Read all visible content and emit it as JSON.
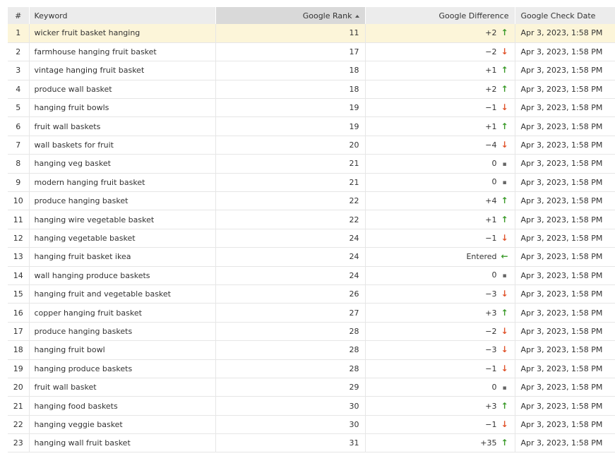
{
  "headers": {
    "num": "#",
    "keyword": "Keyword",
    "rank": "Google Rank",
    "difference": "Google Difference",
    "date": "Google Check Date"
  },
  "colors": {
    "up": "#3a9a29",
    "down": "#e0532b",
    "selected_row": "#fcf5d9"
  },
  "rows": [
    {
      "num": "1",
      "keyword": "wicker fruit basket hanging",
      "rank": "11",
      "diff": "+2",
      "trend": "up",
      "date": "Apr 3, 2023, 1:58 PM"
    },
    {
      "num": "2",
      "keyword": "farmhouse hanging fruit basket",
      "rank": "17",
      "diff": "−2",
      "trend": "down",
      "date": "Apr 3, 2023, 1:58 PM"
    },
    {
      "num": "3",
      "keyword": "vintage hanging fruit basket",
      "rank": "18",
      "diff": "+1",
      "trend": "up",
      "date": "Apr 3, 2023, 1:58 PM"
    },
    {
      "num": "4",
      "keyword": "produce wall basket",
      "rank": "18",
      "diff": "+2",
      "trend": "up",
      "date": "Apr 3, 2023, 1:58 PM"
    },
    {
      "num": "5",
      "keyword": "hanging fruit bowls",
      "rank": "19",
      "diff": "−1",
      "trend": "down",
      "date": "Apr 3, 2023, 1:58 PM"
    },
    {
      "num": "6",
      "keyword": "fruit wall baskets",
      "rank": "19",
      "diff": "+1",
      "trend": "up",
      "date": "Apr 3, 2023, 1:58 PM"
    },
    {
      "num": "7",
      "keyword": "wall baskets for fruit",
      "rank": "20",
      "diff": "−4",
      "trend": "down",
      "date": "Apr 3, 2023, 1:58 PM"
    },
    {
      "num": "8",
      "keyword": "hanging veg basket",
      "rank": "21",
      "diff": "0",
      "trend": "same",
      "date": "Apr 3, 2023, 1:58 PM"
    },
    {
      "num": "9",
      "keyword": "modern hanging fruit basket",
      "rank": "21",
      "diff": "0",
      "trend": "same",
      "date": "Apr 3, 2023, 1:58 PM"
    },
    {
      "num": "10",
      "keyword": "produce hanging basket",
      "rank": "22",
      "diff": "+4",
      "trend": "up",
      "date": "Apr 3, 2023, 1:58 PM"
    },
    {
      "num": "11",
      "keyword": "hanging wire vegetable basket",
      "rank": "22",
      "diff": "+1",
      "trend": "up",
      "date": "Apr 3, 2023, 1:58 PM"
    },
    {
      "num": "12",
      "keyword": "hanging vegetable basket",
      "rank": "24",
      "diff": "−1",
      "trend": "down",
      "date": "Apr 3, 2023, 1:58 PM"
    },
    {
      "num": "13",
      "keyword": "hanging fruit basket ikea",
      "rank": "24",
      "diff": "Entered",
      "trend": "entered",
      "date": "Apr 3, 2023, 1:58 PM"
    },
    {
      "num": "14",
      "keyword": "wall hanging produce baskets",
      "rank": "24",
      "diff": "0",
      "trend": "same",
      "date": "Apr 3, 2023, 1:58 PM"
    },
    {
      "num": "15",
      "keyword": "hanging fruit and vegetable basket",
      "rank": "26",
      "diff": "−3",
      "trend": "down",
      "date": "Apr 3, 2023, 1:58 PM"
    },
    {
      "num": "16",
      "keyword": "copper hanging fruit basket",
      "rank": "27",
      "diff": "+3",
      "trend": "up",
      "date": "Apr 3, 2023, 1:58 PM"
    },
    {
      "num": "17",
      "keyword": "produce hanging baskets",
      "rank": "28",
      "diff": "−2",
      "trend": "down",
      "date": "Apr 3, 2023, 1:58 PM"
    },
    {
      "num": "18",
      "keyword": "hanging fruit bowl",
      "rank": "28",
      "diff": "−3",
      "trend": "down",
      "date": "Apr 3, 2023, 1:58 PM"
    },
    {
      "num": "19",
      "keyword": "hanging produce baskets",
      "rank": "28",
      "diff": "−1",
      "trend": "down",
      "date": "Apr 3, 2023, 1:58 PM"
    },
    {
      "num": "20",
      "keyword": "fruit wall basket",
      "rank": "29",
      "diff": "0",
      "trend": "same",
      "date": "Apr 3, 2023, 1:58 PM"
    },
    {
      "num": "21",
      "keyword": "hanging food baskets",
      "rank": "30",
      "diff": "+3",
      "trend": "up",
      "date": "Apr 3, 2023, 1:58 PM"
    },
    {
      "num": "22",
      "keyword": "hanging veggie basket",
      "rank": "30",
      "diff": "−1",
      "trend": "down",
      "date": "Apr 3, 2023, 1:58 PM"
    },
    {
      "num": "23",
      "keyword": "hanging wall fruit basket",
      "rank": "31",
      "diff": "+35",
      "trend": "up",
      "date": "Apr 3, 2023, 1:58 PM"
    }
  ]
}
